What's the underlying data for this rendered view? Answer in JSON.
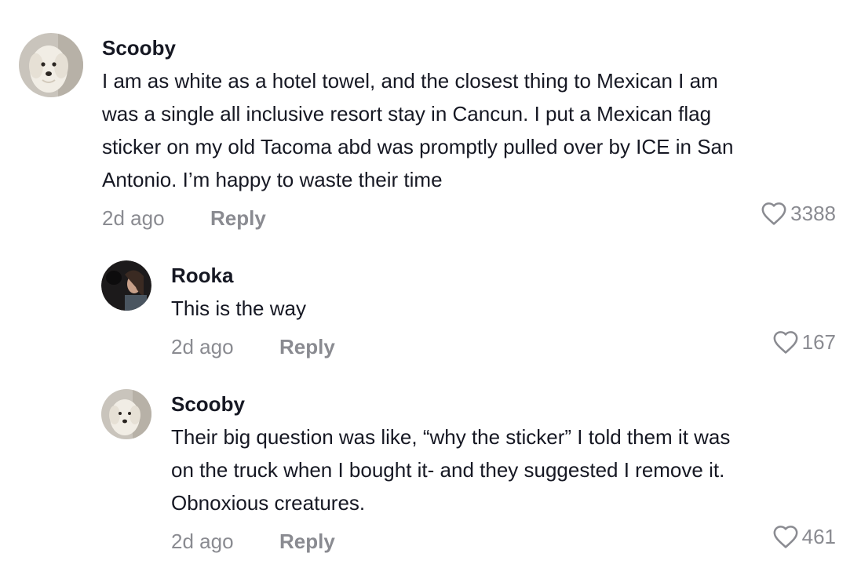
{
  "comments": [
    {
      "username": "Scooby",
      "text_lines": [
        "I am as white as a hotel towel, and the closest thing to Mexican I am",
        "was a single all inclusive resort stay in Cancun. I put a Mexican flag",
        "sticker on my old Tacoma abd was promptly pulled over by ICE in San",
        "Antonio. I’m happy to waste their time"
      ],
      "time": "2d ago",
      "reply_label": "Reply",
      "likes": "3388",
      "avatar_icon": "dog-avatar"
    },
    {
      "username": "Rooka",
      "text_lines": [
        "This is the way"
      ],
      "time": "2d ago",
      "reply_label": "Reply",
      "likes": "167",
      "avatar_icon": "person-avatar"
    },
    {
      "username": "Scooby",
      "text_lines": [
        "Their big question was like, “why the sticker” I told them it was",
        "on the truck when I bought it- and they suggested I remove it.",
        "Obnoxious creatures."
      ],
      "time": "2d ago",
      "reply_label": "Reply",
      "likes": "461",
      "avatar_icon": "dog-avatar"
    }
  ],
  "colors": {
    "text": "#161823",
    "muted": "#8a8b91",
    "background": "#ffffff"
  },
  "icons": {
    "like": "heart-outline-icon"
  }
}
